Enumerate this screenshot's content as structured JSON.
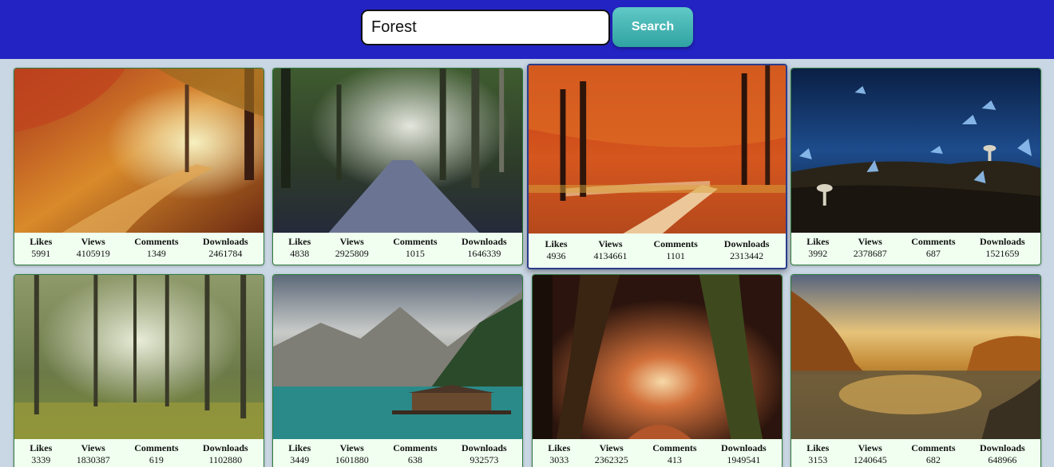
{
  "search": {
    "value": "Forest",
    "button_label": "Search"
  },
  "stat_labels": {
    "likes": "Likes",
    "views": "Views",
    "comments": "Comments",
    "downloads": "Downloads"
  },
  "images": [
    {
      "scene": "autumn-forest-path",
      "likes": "5991",
      "views": "4105919",
      "comments": "1349",
      "downloads": "2461784"
    },
    {
      "scene": "misty-forest-road",
      "likes": "4838",
      "views": "2925809",
      "comments": "1015",
      "downloads": "1646339"
    },
    {
      "scene": "red-autumn-forest-path",
      "likes": "4936",
      "views": "4134661",
      "comments": "1101",
      "downloads": "2313442"
    },
    {
      "scene": "blue-butterflies-mushrooms",
      "likes": "3992",
      "views": "2378687",
      "comments": "687",
      "downloads": "1521659"
    },
    {
      "scene": "green-birch-forest",
      "likes": "3339",
      "views": "1830387",
      "comments": "619",
      "downloads": "1102880"
    },
    {
      "scene": "mountain-lake-boathouse",
      "likes": "3449",
      "views": "1601880",
      "comments": "638",
      "downloads": "932573"
    },
    {
      "scene": "dark-forest-glowing-path",
      "likes": "3033",
      "views": "2362325",
      "comments": "413",
      "downloads": "1949541"
    },
    {
      "scene": "sunset-lake-autumn-trees",
      "likes": "3153",
      "views": "1240645",
      "comments": "682",
      "downloads": "648966"
    }
  ],
  "colors": {
    "header": "#2323c4",
    "background": "#c9d6e3",
    "card": "#f0fff0",
    "button": "#3fb3b1"
  }
}
